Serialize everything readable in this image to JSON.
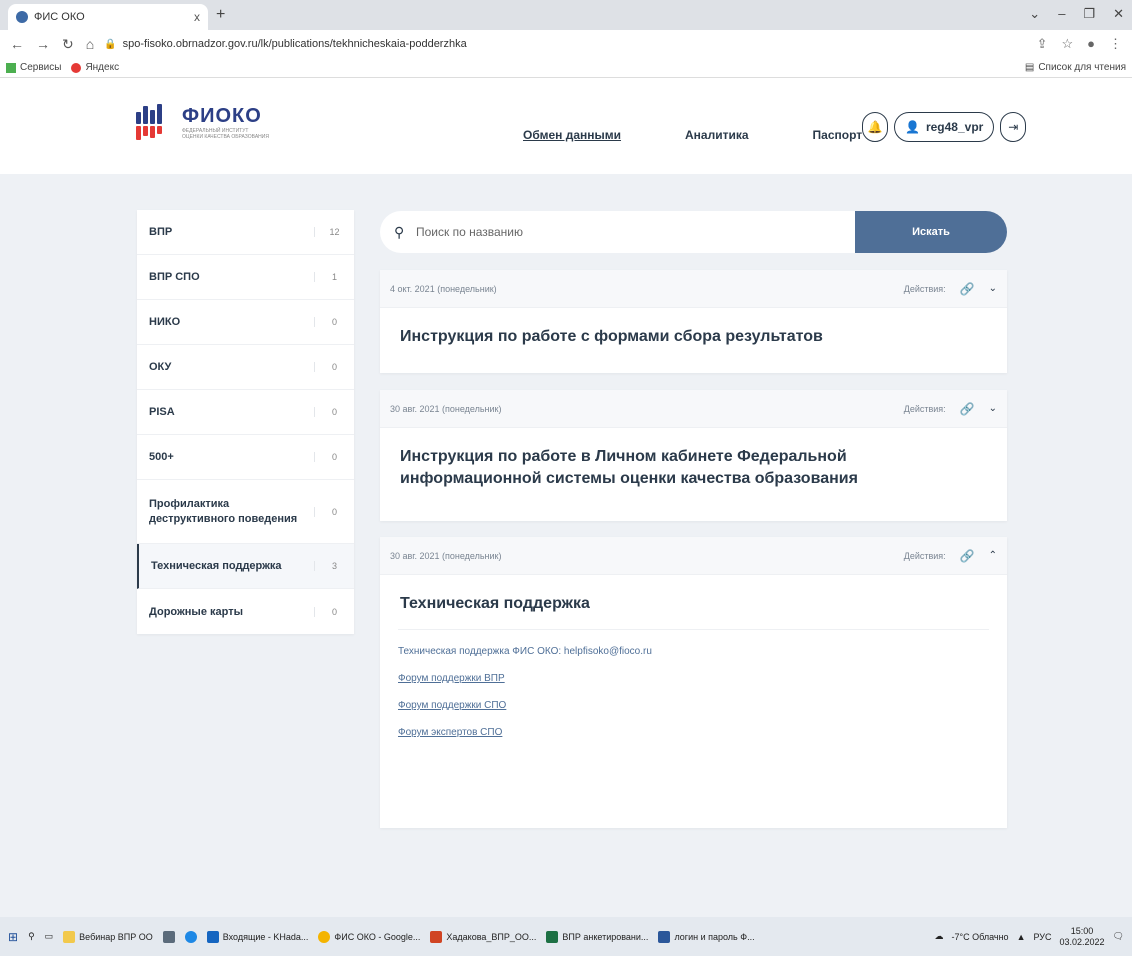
{
  "browser": {
    "tab_title": "ФИС ОКО",
    "tab_close": "x",
    "new_tab": "+",
    "url": "spo-fisoko.obrnadzor.gov.ru/lk/publications/tekhnicheskaia-podderzhka",
    "bookmarks": [
      {
        "label": "Сервисы"
      },
      {
        "label": "Яндекс"
      }
    ],
    "reading_list": "Список для чтения"
  },
  "header": {
    "logo_title": "ФИОКО",
    "logo_sub1": "ФЕДЕРАЛЬНЫЙ ИНСТИТУТ",
    "logo_sub2": "ОЦЕНКИ КАЧЕСТВА ОБРАЗОВАНИЯ",
    "nav": [
      {
        "label": "Обмен данными"
      },
      {
        "label": "Аналитика"
      },
      {
        "label": "Паспорт"
      }
    ],
    "username": "reg48_vpr"
  },
  "sidebar": {
    "items": [
      {
        "label": "ВПР",
        "count": "12"
      },
      {
        "label": "ВПР СПО",
        "count": "1"
      },
      {
        "label": "НИКО",
        "count": "0"
      },
      {
        "label": "ОКУ",
        "count": "0"
      },
      {
        "label": "PISA",
        "count": "0"
      },
      {
        "label": "500+",
        "count": "0"
      },
      {
        "label": "Профилактика деструктивного поведения",
        "count": "0"
      },
      {
        "label": "Техническая поддержка",
        "count": "3"
      },
      {
        "label": "Дорожные карты",
        "count": "0"
      }
    ]
  },
  "search": {
    "placeholder": "Поиск по названию",
    "button": "Искать"
  },
  "publications": [
    {
      "date": "4 окт. 2021 (понедельник)",
      "actions": "Действия:",
      "title": "Инструкция по работе с формами сбора результатов"
    },
    {
      "date": "30 авг. 2021 (понедельник)",
      "actions": "Действия:",
      "title": "Инструкция по работе в Личном кабинете Федеральной информационной системы оценки качества образования"
    },
    {
      "date": "30 авг. 2021 (понедельник)",
      "actions": "Действия:",
      "title": "Техническая поддержка"
    }
  ],
  "support": {
    "contact": "Техническая поддержка ФИС ОКО: helpfisoko@fioco.ru",
    "links": [
      {
        "label": "Форум поддержки ВПР"
      },
      {
        "label": "Форум поддержки СПО"
      },
      {
        "label": "Форум экспертов СПО"
      }
    ]
  },
  "taskbar": {
    "apps": [
      {
        "label": "Вебинар ВПР ОО"
      },
      {
        "label": "Входящие - KHada..."
      },
      {
        "label": "ФИС ОКО - Google..."
      },
      {
        "label": "Хадакова_ВПР_ОО..."
      },
      {
        "label": "ВПР анкетировани..."
      },
      {
        "label": "логин и пароль Ф..."
      }
    ],
    "weather": "-7°C Облачно",
    "lang": "РУС",
    "time": "15:00",
    "date": "03.02.2022"
  }
}
